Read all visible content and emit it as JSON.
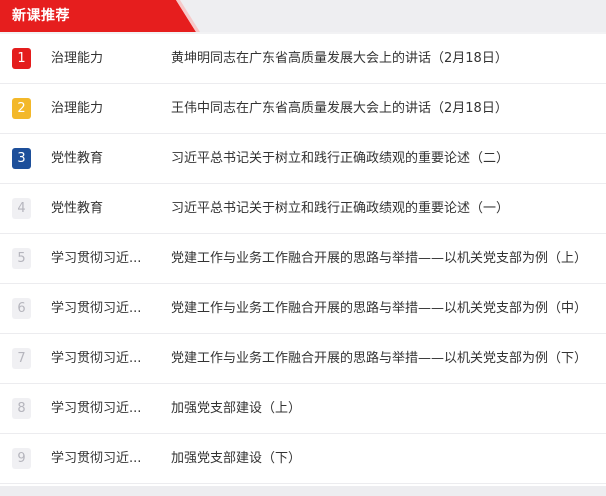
{
  "header": {
    "title": "新课推荐"
  },
  "courses": [
    {
      "rank": "1",
      "category": "治理能力",
      "title": "黄坤明同志在广东省高质量发展大会上的讲话（2月18日）"
    },
    {
      "rank": "2",
      "category": "治理能力",
      "title": "王伟中同志在广东省高质量发展大会上的讲话（2月18日）"
    },
    {
      "rank": "3",
      "category": "党性教育",
      "title": "习近平总书记关于树立和践行正确政绩观的重要论述（二）"
    },
    {
      "rank": "4",
      "category": "党性教育",
      "title": "习近平总书记关于树立和践行正确政绩观的重要论述（一）"
    },
    {
      "rank": "5",
      "category": "学习贯彻习近...",
      "title": "党建工作与业务工作融合开展的思路与举措——以机关党支部为例（上）"
    },
    {
      "rank": "6",
      "category": "学习贯彻习近...",
      "title": "党建工作与业务工作融合开展的思路与举措——以机关党支部为例（中）"
    },
    {
      "rank": "7",
      "category": "学习贯彻习近...",
      "title": "党建工作与业务工作融合开展的思路与举措——以机关党支部为例（下）"
    },
    {
      "rank": "8",
      "category": "学习贯彻习近...",
      "title": "加强党支部建设（上）"
    },
    {
      "rank": "9",
      "category": "学习贯彻习近...",
      "title": "加强党支部建设（下）"
    }
  ],
  "colors": {
    "brand_red": "#e61e1e",
    "rank_1": "#e41d1d",
    "rank_2": "#f3b82a",
    "rank_3": "#1d4f9a",
    "rank_other": "#f0f0f3"
  }
}
